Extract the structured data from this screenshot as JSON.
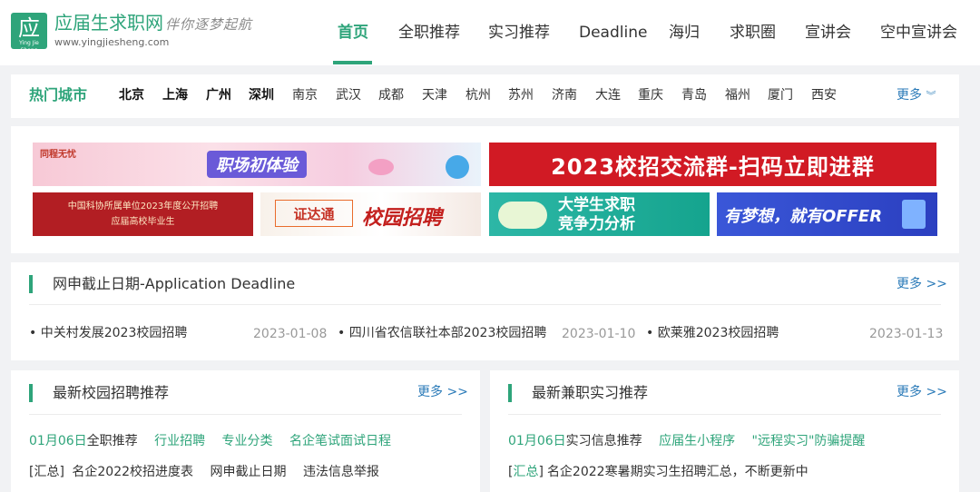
{
  "header": {
    "logo_glyph": "应",
    "logo_mini": "Ying Jie Sheng",
    "site_name": "应届生求职网",
    "slogan": "伴你逐梦起航",
    "site_url": "www.yingjiesheng.com",
    "nav": [
      "首页",
      "全职推荐",
      "实习推荐",
      "Deadline",
      "海归",
      "求职圈",
      "宣讲会",
      "空中宣讲会"
    ],
    "active_nav": "首页"
  },
  "cities": {
    "title": "热门城市",
    "hot": [
      "北京",
      "上海",
      "广州",
      "深圳"
    ],
    "others": [
      "南京",
      "武汉",
      "成都",
      "天津",
      "杭州",
      "苏州",
      "济南",
      "大连",
      "重庆",
      "青岛",
      "福州",
      "厦门",
      "西安"
    ],
    "more": "更多"
  },
  "banners": {
    "b1_title": "职场初体验",
    "b1_corp": "同程无忧",
    "b2_title": "2023校招交流群-扫码立即进群",
    "b3_line1": "中国科协所属单位2023年度公开招聘",
    "b3_line2": "应届高校毕业生",
    "b4_logo": "证达通",
    "b4_title": "校园招聘",
    "b5_line1": "大学生求职",
    "b5_line2": "竞争力分析",
    "b6_title": "有梦想，就有OFFER"
  },
  "deadline": {
    "title": "网申截止日期-Application Deadline",
    "more": "更多 >>",
    "items": [
      {
        "name": "中关村发展2023校园招聘",
        "date": "2023-01-08"
      },
      {
        "name": "四川省农信联社本部2023校园招聘",
        "date": "2023-01-10"
      },
      {
        "name": "欧莱雅2023校园招聘",
        "date": "2023-01-13"
      }
    ]
  },
  "campus": {
    "title": "最新校园招聘推荐",
    "more": "更多 >>",
    "row1": {
      "date": "01月06日",
      "head": "全职推荐",
      "links": [
        "行业招聘",
        "专业分类",
        "名企笔试面试日程"
      ]
    },
    "row2": {
      "tag": "[汇总]",
      "links": [
        "名企2022校招进度表",
        "网申截止日期",
        "违法信息举报"
      ]
    }
  },
  "intern": {
    "title": "最新兼职实习推荐",
    "more": "更多 >>",
    "row1": {
      "date": "01月06日",
      "head": "实习信息推荐",
      "links": [
        "应届生小程序",
        "\"远程实习\"防骗提醒"
      ]
    },
    "row2": {
      "tag_open": "[",
      "tag_word": "汇总",
      "tag_close": "]",
      "text": "名企2022寒暑期实习生招聘汇总，不断更新中"
    }
  },
  "colors": {
    "brand": "#2ea47a",
    "link": "#2a7ab8"
  }
}
